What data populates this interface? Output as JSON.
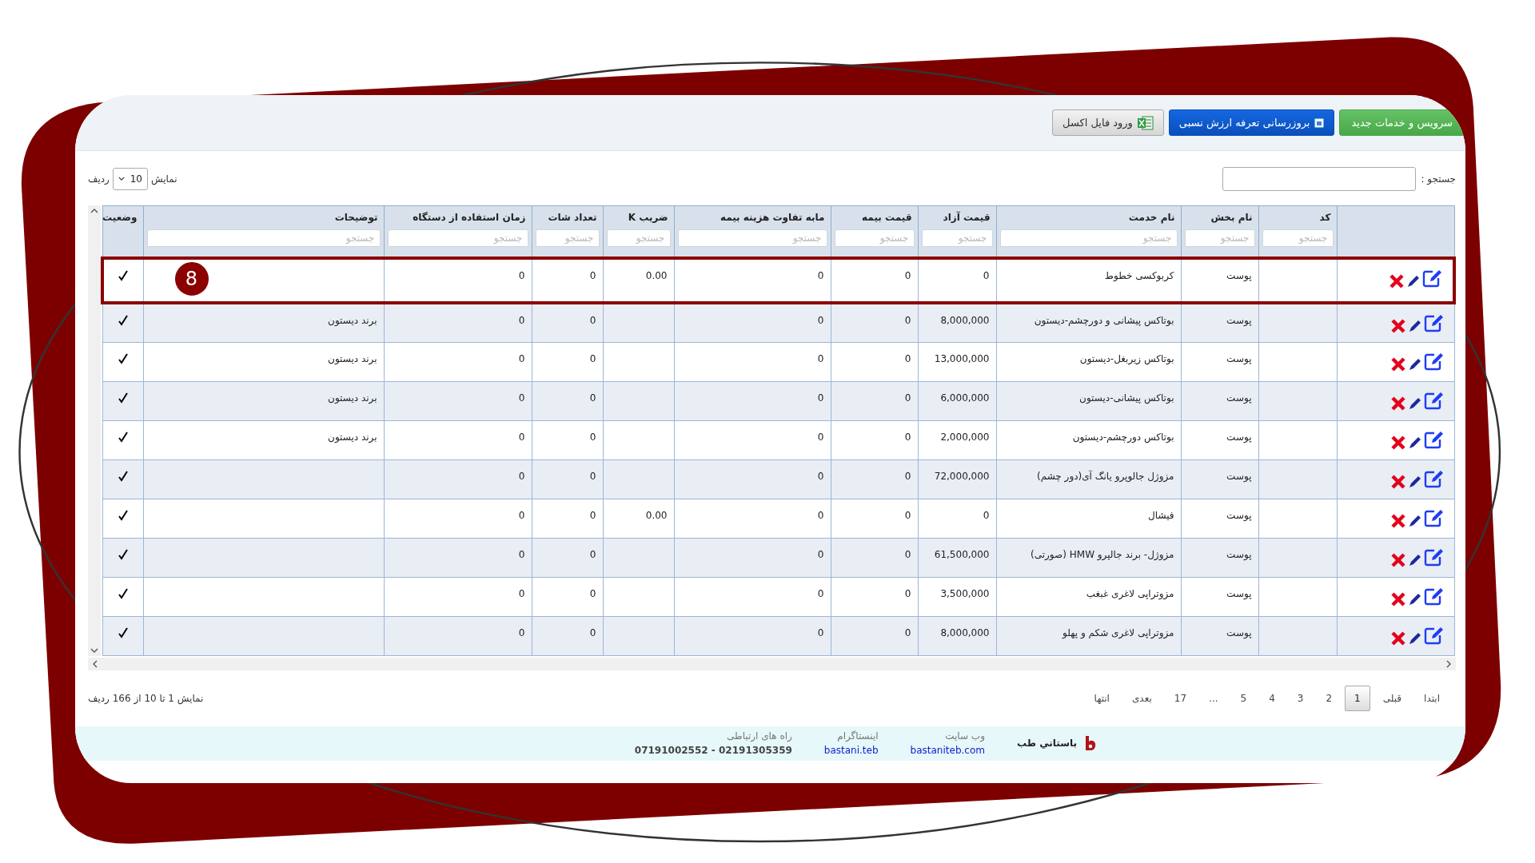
{
  "toolbar": {
    "buttons": [
      {
        "kind": "new",
        "label": "سرویس و خدمات جدید"
      },
      {
        "kind": "update",
        "label": "بروزرسانی تعرفه ارزش نسبی"
      },
      {
        "kind": "excel",
        "label": "ورود فایل اکسل"
      }
    ]
  },
  "search": {
    "label": "جستجو :"
  },
  "page_size": {
    "prefix": "نمایش",
    "value": "10",
    "suffix": "ردیف"
  },
  "table": {
    "columns": [
      {
        "kind": "actions"
      },
      {
        "label": "کد",
        "placeholder": "جستجو"
      },
      {
        "label": "نام بخش",
        "placeholder": "جستجو"
      },
      {
        "label": "نام خدمت",
        "placeholder": "جستجو"
      },
      {
        "label": "قیمت آزاد",
        "placeholder": "جستجو"
      },
      {
        "label": "قیمت بیمه",
        "placeholder": "جستجو"
      },
      {
        "label": "مابه تفاوت هزینه بیمه",
        "placeholder": "جستجو"
      },
      {
        "label": "ضریب K",
        "placeholder": "جستجو"
      },
      {
        "label": "تعداد شات",
        "placeholder": "جستجو"
      },
      {
        "label": "زمان استفاده از دستگاه",
        "placeholder": "جستجو"
      },
      {
        "label": "توضیحات",
        "placeholder": "جستجو"
      },
      {
        "label": "وضعیت"
      }
    ],
    "rows": [
      {
        "highlighted": true,
        "section": "پوست",
        "service": "کربوکسی خطوط",
        "free_price": "0",
        "insurance_price": "0",
        "insurance_diff": "0",
        "k_factor": "0.00",
        "shots": "0",
        "usage_time": "0",
        "checked": true
      },
      {
        "highlighted": false,
        "section": "پوست",
        "service": "بوتاکس پیشانی و دورچشم-دیستون",
        "free_price": "8,000,000",
        "insurance_price": "0",
        "insurance_diff": "0",
        "shots": "0",
        "usage_time": "0",
        "description": "برند دیستون",
        "checked": true
      },
      {
        "highlighted": false,
        "section": "پوست",
        "service": "بوتاکس زیربغل-دیستون",
        "free_price": "13,000,000",
        "insurance_price": "0",
        "insurance_diff": "0",
        "shots": "0",
        "usage_time": "0",
        "description": "برند دیستون",
        "checked": true
      },
      {
        "highlighted": false,
        "section": "پوست",
        "service": "بوتاکس پیشانی-دیستون",
        "free_price": "6,000,000",
        "insurance_price": "0",
        "insurance_diff": "0",
        "shots": "0",
        "usage_time": "0",
        "description": "برند دیستون",
        "checked": true
      },
      {
        "highlighted": false,
        "section": "پوست",
        "service": "بوتاکس دورچشم-دیستون",
        "free_price": "2,000,000",
        "insurance_price": "0",
        "insurance_diff": "0",
        "shots": "0",
        "usage_time": "0",
        "description": "برند دیستون",
        "checked": true
      },
      {
        "highlighted": false,
        "section": "پوست",
        "service": "مزوژل جالوپرو یانگ آی(دور چشم)",
        "free_price": "72,000,000",
        "insurance_price": "0",
        "insurance_diff": "0",
        "shots": "0",
        "usage_time": "0",
        "checked": true
      },
      {
        "highlighted": false,
        "section": "پوست",
        "service": "فیشال",
        "free_price": "0",
        "insurance_price": "0",
        "insurance_diff": "0",
        "k_factor": "0.00",
        "shots": "0",
        "usage_time": "0",
        "checked": true
      },
      {
        "highlighted": false,
        "section": "پوست",
        "service": "مزوژل- برند جالپرو HMW (صورتی)",
        "free_price": "61,500,000",
        "insurance_price": "0",
        "insurance_diff": "0",
        "shots": "0",
        "usage_time": "0",
        "checked": true
      },
      {
        "highlighted": false,
        "section": "پوست",
        "service": "مزوتراپی لاغری غبغب",
        "free_price": "3,500,000",
        "insurance_price": "0",
        "insurance_diff": "0",
        "shots": "0",
        "usage_time": "0",
        "checked": true
      },
      {
        "highlighted": false,
        "section": "پوست",
        "service": "مزوتراپی لاغری شکم و پهلو",
        "free_price": "8,000,000",
        "insurance_price": "0",
        "insurance_diff": "0",
        "shots": "0",
        "usage_time": "0",
        "checked": true
      }
    ]
  },
  "annotation": {
    "badge": "8"
  },
  "pagination": {
    "pages": [
      {
        "label": "ابتدا",
        "selected": false
      },
      {
        "label": "قبلی",
        "selected": false
      },
      {
        "label": "1",
        "selected": true
      },
      {
        "label": "2",
        "selected": false
      },
      {
        "label": "3",
        "selected": false
      },
      {
        "label": "4",
        "selected": false
      },
      {
        "label": "5",
        "selected": false
      },
      {
        "label": "...",
        "selected": false
      },
      {
        "label": "17",
        "selected": false
      },
      {
        "label": "بعدی",
        "selected": false
      },
      {
        "label": "انتها",
        "selected": false
      }
    ],
    "info": "نمایش 1 تا 10 از 166 ردیف"
  },
  "footer": {
    "brand": "باستاني طب",
    "links": [
      {
        "label": "وب سایت",
        "value": "bastaniteb.com",
        "kind": "link"
      },
      {
        "label": "اینستاگرام",
        "value": "bastani.teb",
        "kind": "link"
      },
      {
        "label": "راه های ارتباطی",
        "value": "07191002552 - 02191305359",
        "kind": "text"
      }
    ]
  }
}
